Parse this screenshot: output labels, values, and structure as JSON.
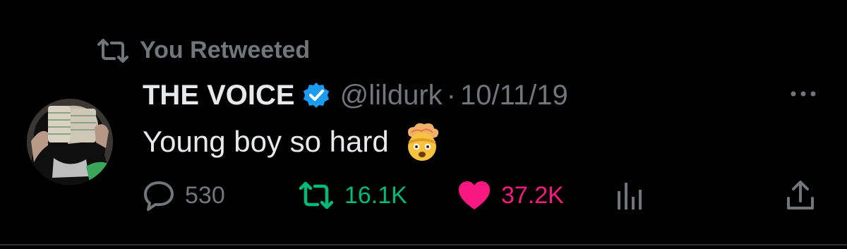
{
  "social_context": {
    "text": "You Retweeted",
    "icon": "retweet-icon"
  },
  "tweet": {
    "display_name": "THE VOICE",
    "verified": true,
    "handle": "@lildurk",
    "separator": "·",
    "date": "10/11/19",
    "text": "Young boy so hard",
    "emoji": "exploding-head-emoji"
  },
  "actions": {
    "reply_count": "530",
    "retweet_count": "16.1K",
    "like_count": "37.2K"
  },
  "colors": {
    "background": "#000000",
    "muted": "#71767b",
    "verified": "#1d9bf0",
    "retweet": "#00ba7c",
    "like": "#f91880"
  }
}
